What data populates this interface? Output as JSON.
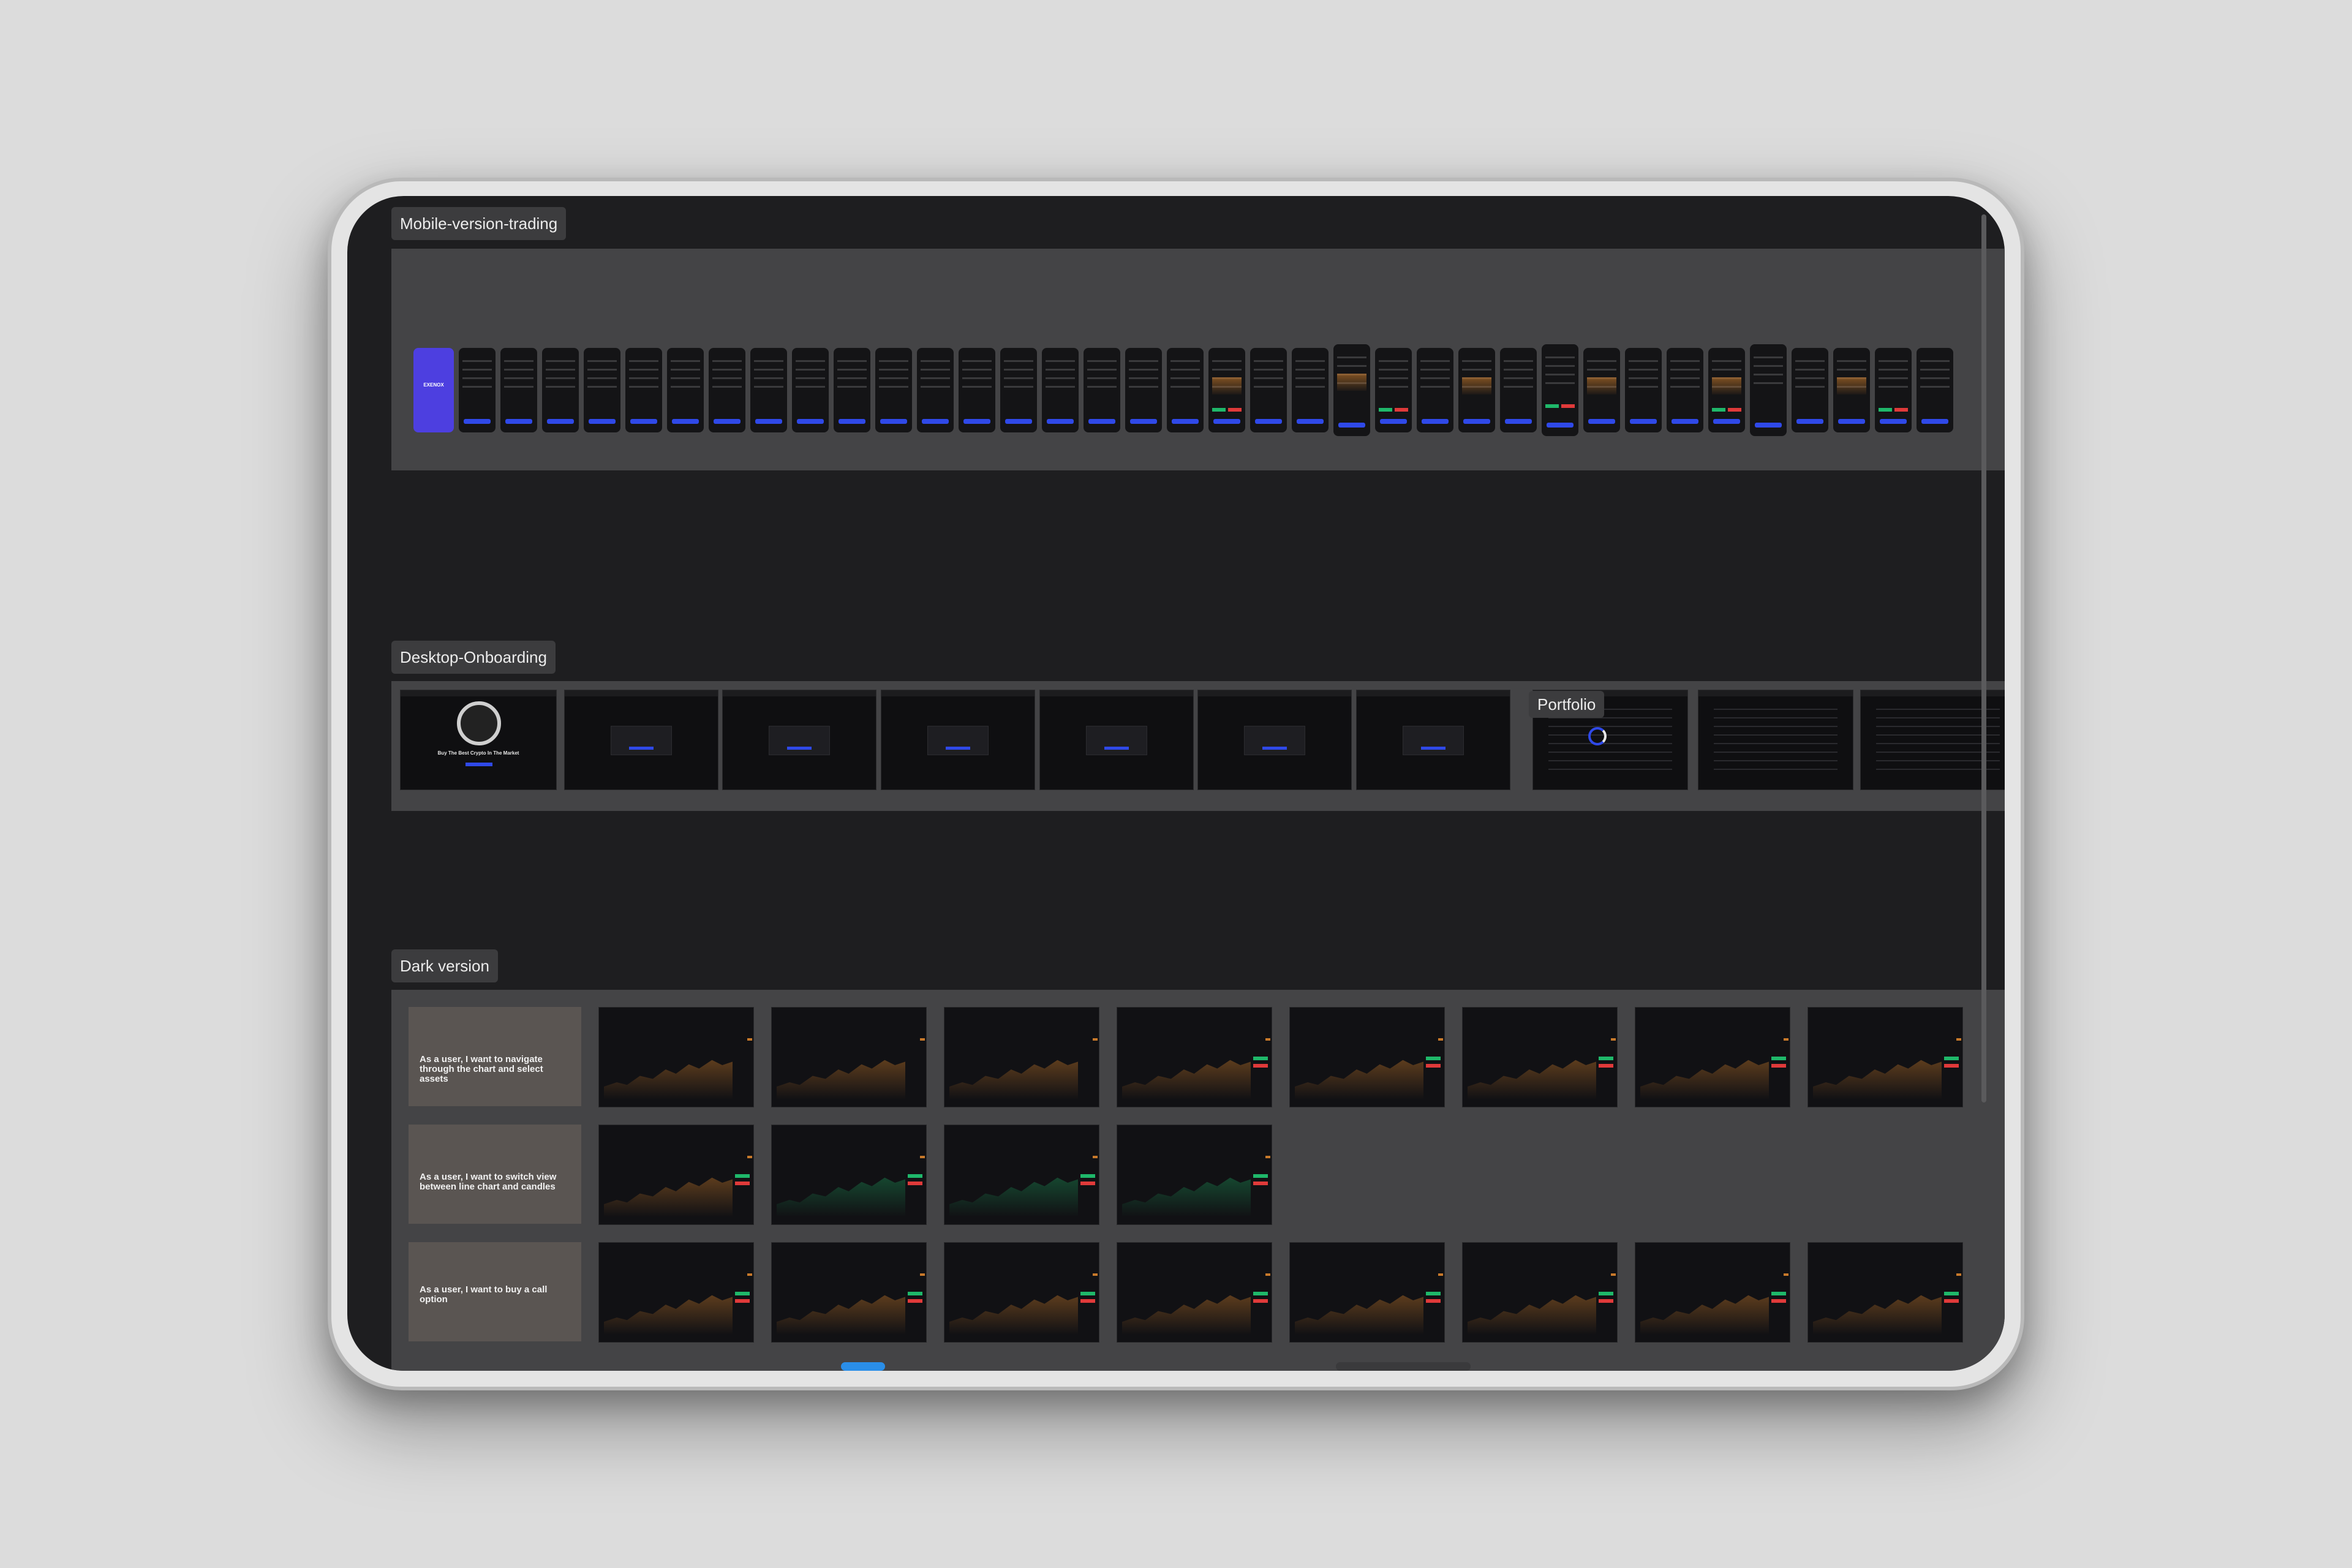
{
  "sections": {
    "mobile": {
      "label": "Mobile-version-trading"
    },
    "onboarding": {
      "label": "Desktop-Onboarding"
    },
    "portfolio": {
      "label": "Portfolio"
    },
    "dark": {
      "label": "Dark version"
    }
  },
  "mobile_screens": {
    "logo_text": "EXENOX"
  },
  "user_stories": [
    {
      "text": "As a user, I want to navigate through the chart and select assets"
    },
    {
      "text": "As a user, I want to switch view between line chart and candles"
    },
    {
      "text": "As a user, I want to buy a call option"
    }
  ],
  "onboarding_hero": {
    "headline": "Buy The Best Crypto In The Market"
  },
  "colors": {
    "accent": "#2f49e8",
    "buy": "#1fb86a",
    "sell": "#e03a3a",
    "chart_line": "#c7792a",
    "mobile_splash": "#4d3fe0"
  }
}
